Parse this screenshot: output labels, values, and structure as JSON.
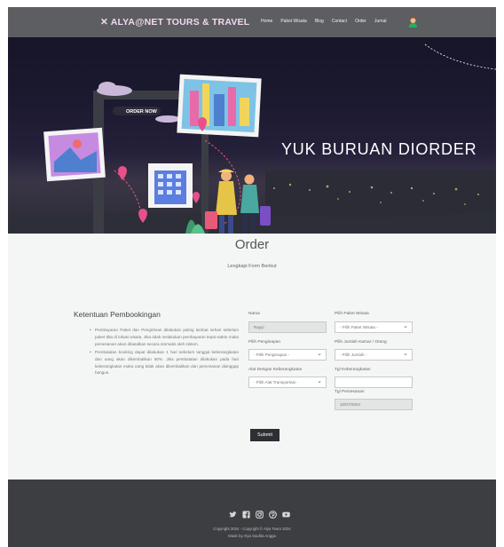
{
  "nav": {
    "brand": "ALYA@NET TOURS & TRAVEL",
    "links": [
      "Home",
      "Paket Wisata",
      "Blog",
      "Contact",
      "Order",
      "Jurnal"
    ]
  },
  "hero": {
    "headline": "YUK BURUAN DIORDER",
    "order_now": "ORDER NOW"
  },
  "order": {
    "title": "Order",
    "subtitle": "Lengkapi Form Berikut"
  },
  "terms": {
    "title": "Ketentuan Pembookingan",
    "items": [
      "Pembayaran Paket dan Pengiriman dilakukan paling lambat sehari sebelum paket tiba di lokasi wisata. Jika tidak melakukan pembayaran tepat waktu maka pemesanan akan dibatalkan secara otomatis oleh sistem.",
      "Pembatalan booking dapat dilakukan 1 hari sebelum tanggal keberangkatan dan uang akan dikembalikan 50%. Jika pembatalan dilakukan pada hari keberangkatan maka uang tidak akan dikembalikan dan pemesanan dianggap hangus."
    ]
  },
  "form": {
    "nama": {
      "label": "Nama",
      "value": "Rayyi"
    },
    "paket": {
      "label": "Pilih Paket Wisata",
      "value": "- Pilih Paket Wisata -"
    },
    "penginapan": {
      "label": "Pilih Penginapan",
      "value": "- Pilih Penginapan -"
    },
    "kamar": {
      "label": "Pilih Jumlah Kamar / Orang",
      "value": "- Pilih Jumlah -"
    },
    "alat": {
      "label": "Alat Dengan Keberangkatan",
      "value": "- Pilih Alat Transportasi -"
    },
    "tgl_berangkat": {
      "label": "Tgl Keberangkatan",
      "value": ""
    },
    "tgl_pemesanan": {
      "label": "Tgl Pemesanan",
      "value": "10/07/2024"
    },
    "submit": "Submit"
  },
  "footer": {
    "icons": [
      "twitter-icon",
      "facebook-icon",
      "instagram-icon",
      "pinterest-icon",
      "youtube-icon"
    ],
    "copyright": "Copyright 2024 - Copyright © Alya Team 2024",
    "credit": "Made by Alya Saufita Angga"
  }
}
